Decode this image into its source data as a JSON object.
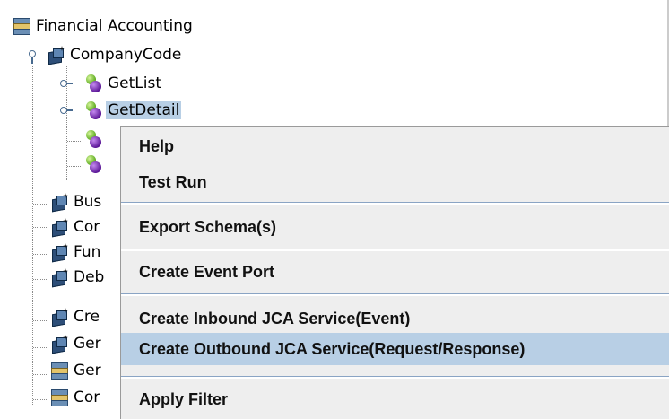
{
  "tree": {
    "root": {
      "label": "Financial Accounting",
      "icon": "database-icon"
    },
    "company_code": {
      "label": "CompanyCode",
      "icon": "business-object-icon"
    },
    "methods": [
      {
        "label": "GetList",
        "icon": "method-icon"
      },
      {
        "label": "GetDetail",
        "icon": "method-icon",
        "selected": true
      },
      {
        "label": "",
        "icon": "method-icon"
      },
      {
        "label": "",
        "icon": "method-icon"
      }
    ],
    "siblings": [
      {
        "label": "Bus",
        "icon": "business-object-icon"
      },
      {
        "label": "Cor",
        "icon": "business-object-icon"
      },
      {
        "label": "Fun",
        "icon": "business-object-icon"
      },
      {
        "label": "Deb",
        "icon": "business-object-icon"
      },
      {
        "label": "Cre",
        "icon": "business-object-icon"
      },
      {
        "label": "Ger",
        "icon": "business-object-icon"
      },
      {
        "label": "Ger",
        "icon": "database-icon"
      },
      {
        "label": "Cor",
        "icon": "database-icon"
      }
    ]
  },
  "context_menu": {
    "items": [
      {
        "label": "Help"
      },
      {
        "label": "Test Run"
      },
      {
        "label": "Export Schema(s)"
      },
      {
        "label": "Create Event Port"
      },
      {
        "label": "Create Inbound JCA Service(Event)"
      },
      {
        "label": "Create Outbound JCA Service(Request/Response)",
        "highlighted": true
      },
      {
        "label": "Apply Filter"
      }
    ]
  },
  "colors": {
    "selection": "#b8cfe5",
    "menu_background": "#eeeeee",
    "separator": "#8aa4c4"
  }
}
